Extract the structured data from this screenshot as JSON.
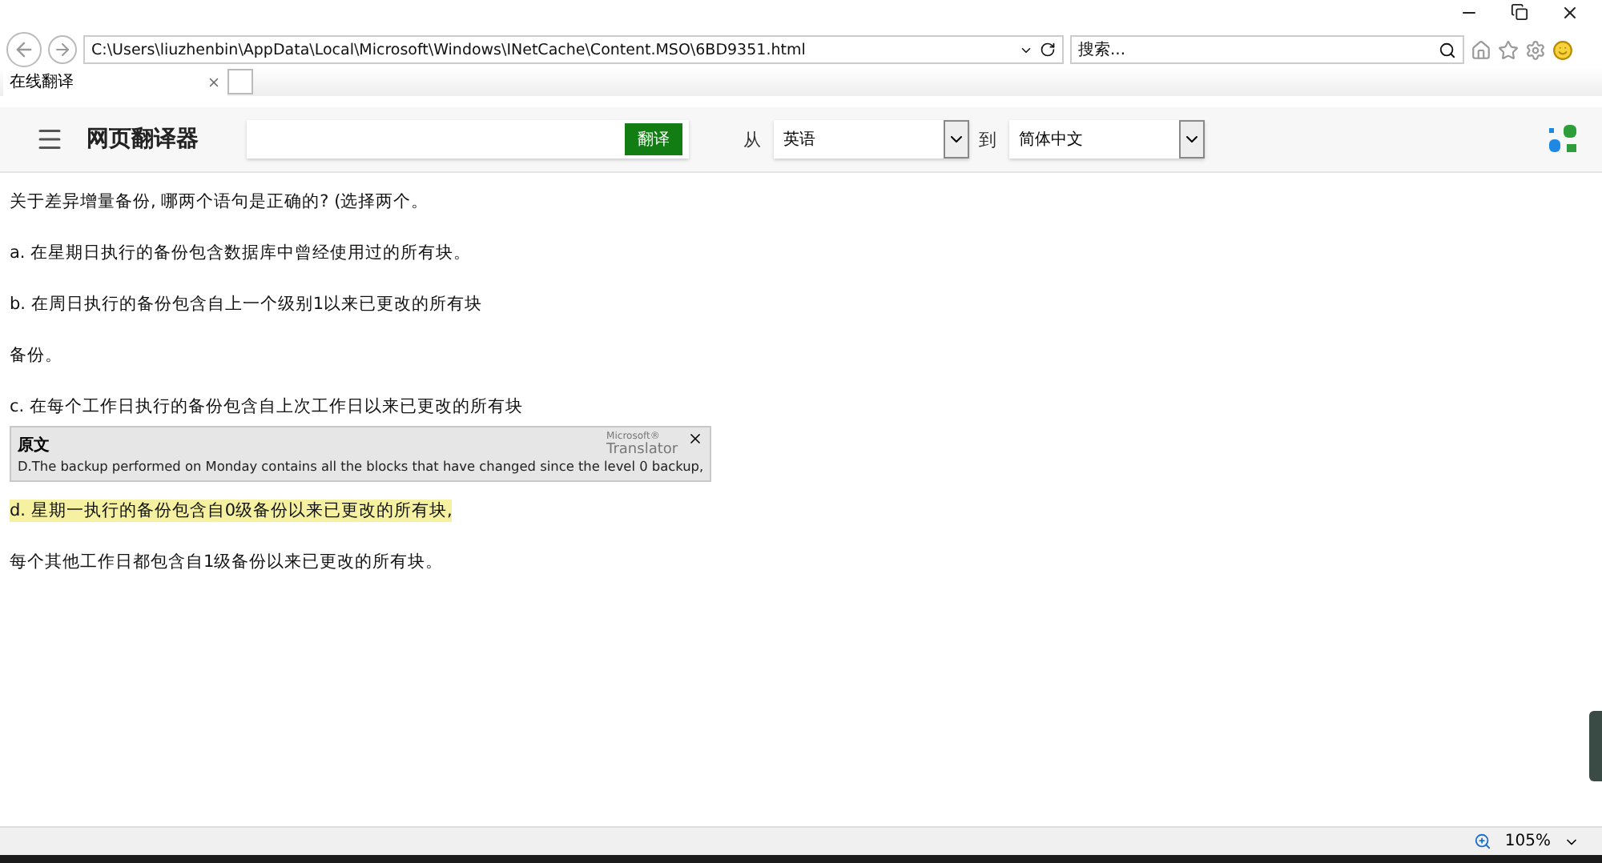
{
  "browser": {
    "address": "C:\\Users\\liuzhenbin\\AppData\\Local\\Microsoft\\Windows\\INetCache\\Content.MSO\\6BD9351.html",
    "search_placeholder": "搜索...",
    "tabs": [
      {
        "label": "在线翻译",
        "selected": true
      }
    ]
  },
  "translator": {
    "title": "网页翻译器",
    "translate_button": "翻译",
    "from_label": "从",
    "from_language": "英语",
    "to_label": "到",
    "to_language": "简体中文"
  },
  "paragraphs": [
    {
      "text": "关于差异增量备份, 哪两个语句是正确的?  (选择两个。",
      "highlighted": false
    },
    {
      "text": "a. 在星期日执行的备份包含数据库中曾经使用过的所有块。",
      "highlighted": false
    },
    {
      "text": "b. 在周日执行的备份包含自上一个级别1以来已更改的所有块",
      "highlighted": false
    },
    {
      "text": "备份。",
      "highlighted": false
    },
    {
      "text": "c. 在每个工作日执行的备份包含自上次工作日以来已更改的所有块",
      "highlighted": false
    },
    {
      "text": "d. 星期一执行的备份包含自0级备份以来已更改的所有块,",
      "highlighted": true
    },
    {
      "text": "每个其他工作日都包含自1级备份以来已更改的所有块。",
      "highlighted": false
    }
  ],
  "popup": {
    "title": "原文",
    "brand_small": "Microsoft®",
    "brand": "Translator",
    "original": "D.The backup performed on Monday contains all the blocks that have changed since the level 0 backup,"
  },
  "status_bar": {
    "zoom": "105%"
  }
}
